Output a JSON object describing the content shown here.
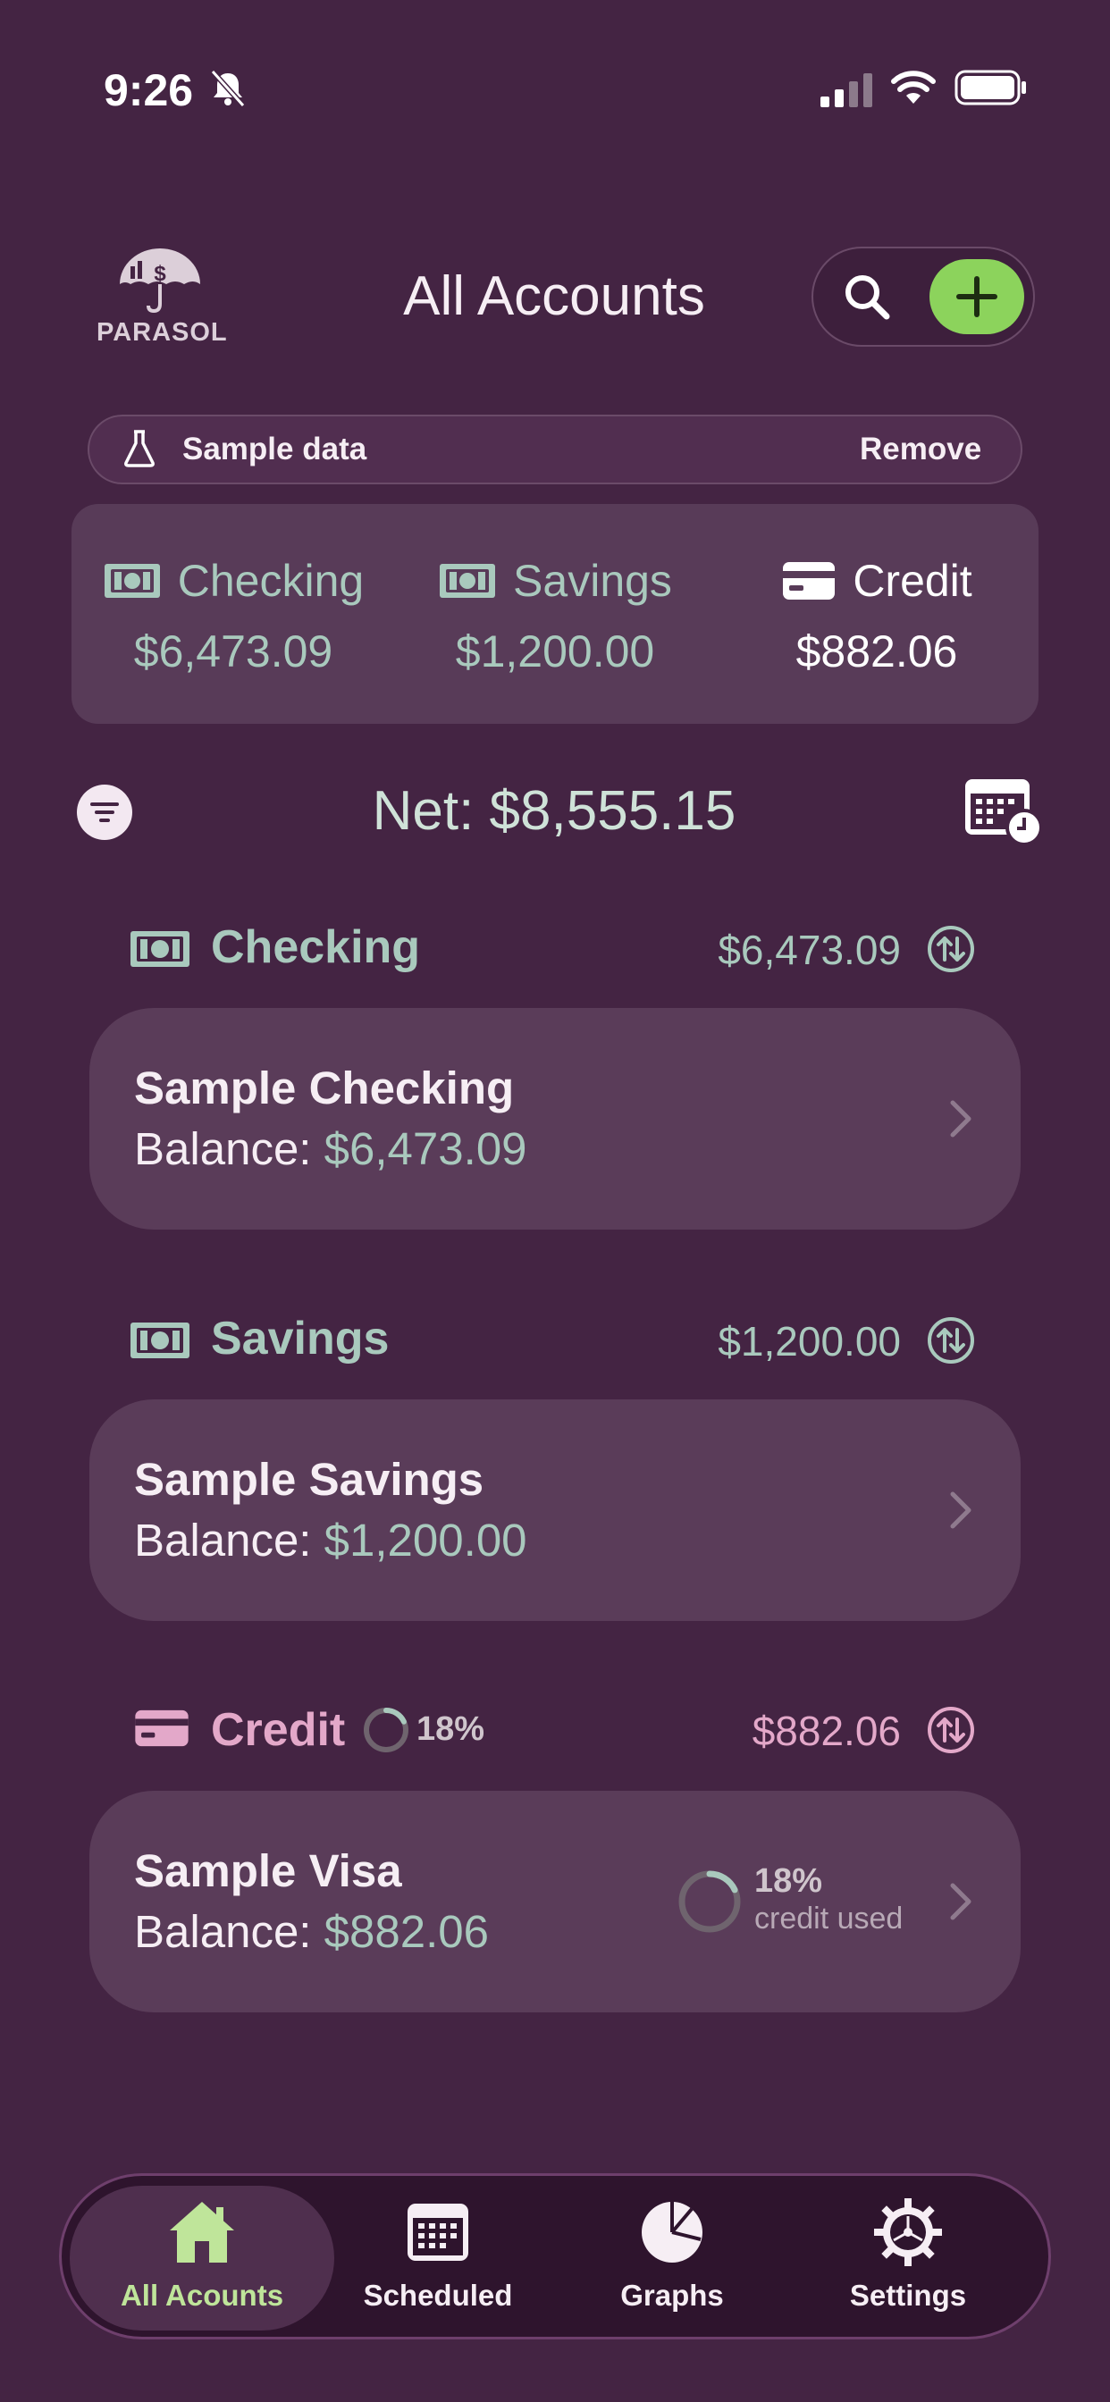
{
  "status_bar": {
    "time": "9:26"
  },
  "header": {
    "logo_text": "PARASOL",
    "title": "All Accounts"
  },
  "banner": {
    "label": "Sample data",
    "action": "Remove"
  },
  "summary": {
    "checking": {
      "label": "Checking",
      "value": "$6,473.09"
    },
    "savings": {
      "label": "Savings",
      "value": "$1,200.00"
    },
    "credit": {
      "label": "Credit",
      "value": "$882.06"
    }
  },
  "net": {
    "label": "Net: $8,555.15"
  },
  "sections": {
    "checking": {
      "title": "Checking",
      "total": "$6,473.09",
      "account": {
        "name": "Sample Checking",
        "balance_label": "Balance: ",
        "balance": "$6,473.09"
      }
    },
    "savings": {
      "title": "Savings",
      "total": "$1,200.00",
      "account": {
        "name": "Sample Savings",
        "balance_label": "Balance: ",
        "balance": "$1,200.00"
      }
    },
    "credit": {
      "title": "Credit",
      "utilization": "18%",
      "utilization_fraction": 0.18,
      "total": "$882.06",
      "account": {
        "name": "Sample Visa",
        "balance_label": "Balance: ",
        "balance": "$882.06",
        "used_pct": "18%",
        "used_label": "credit used"
      }
    }
  },
  "tabs": [
    {
      "label": "All Acounts",
      "icon": "home-icon",
      "active": true
    },
    {
      "label": "Scheduled",
      "icon": "calendar-icon",
      "active": false
    },
    {
      "label": "Graphs",
      "icon": "pie-chart-icon",
      "active": false
    },
    {
      "label": "Settings",
      "icon": "gear-icon",
      "active": false
    }
  ],
  "colors": {
    "background": "#442443",
    "accent_green": "#8cd35c",
    "money_green": "#a9c9bd",
    "credit_pink": "#e3a8c9"
  }
}
